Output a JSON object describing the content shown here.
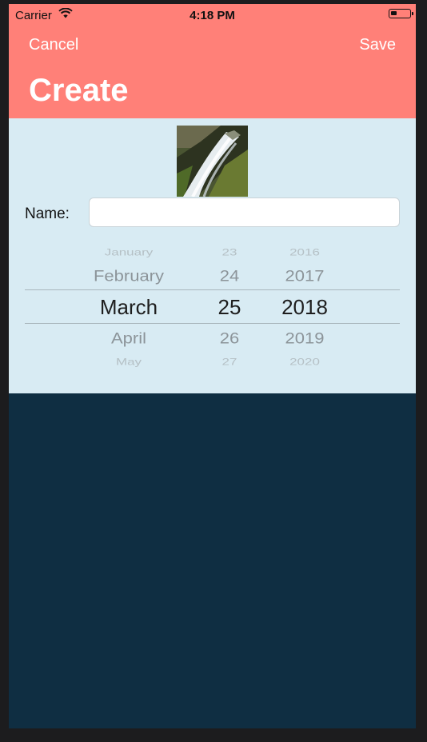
{
  "status": {
    "carrier": "Carrier",
    "time": "4:18 PM"
  },
  "nav": {
    "cancel": "Cancel",
    "save": "Save",
    "title": "Create"
  },
  "form": {
    "name_label": "Name:",
    "name_value": ""
  },
  "picker": {
    "months": [
      "January",
      "February",
      "March",
      "April",
      "May"
    ],
    "days": [
      "23",
      "24",
      "25",
      "26",
      "27"
    ],
    "years": [
      "2016",
      "2017",
      "2018",
      "2019",
      "2020"
    ]
  },
  "colors": {
    "header": "#ff8078",
    "content": "#d8ebf3",
    "background": "#0f2e42"
  }
}
